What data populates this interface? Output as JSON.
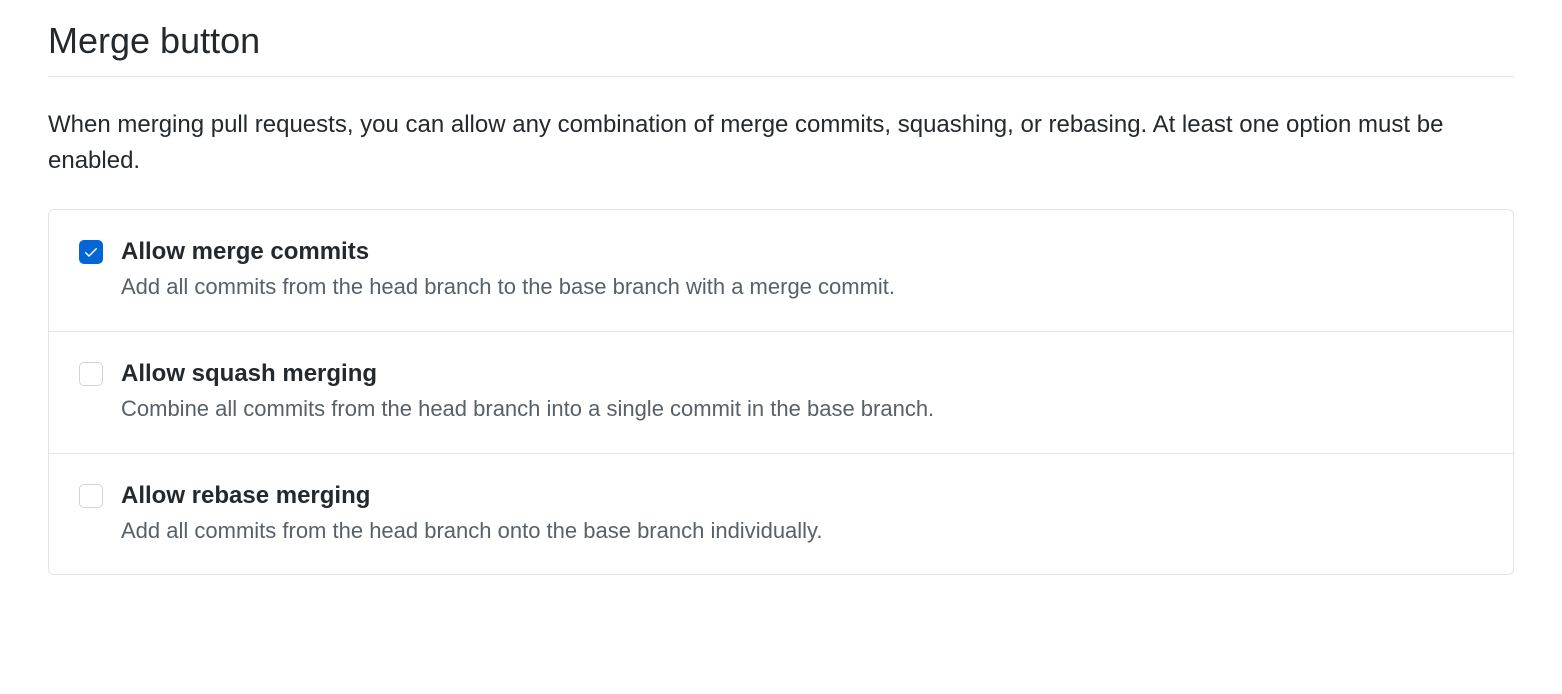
{
  "section": {
    "title": "Merge button",
    "description": "When merging pull requests, you can allow any combination of merge commits, squashing, or rebasing. At least one option must be enabled."
  },
  "options": [
    {
      "title": "Allow merge commits",
      "description": "Add all commits from the head branch to the base branch with a merge commit.",
      "checked": true
    },
    {
      "title": "Allow squash merging",
      "description": "Combine all commits from the head branch into a single commit in the base branch.",
      "checked": false
    },
    {
      "title": "Allow rebase merging",
      "description": "Add all commits from the head branch onto the base branch individually.",
      "checked": false
    }
  ]
}
